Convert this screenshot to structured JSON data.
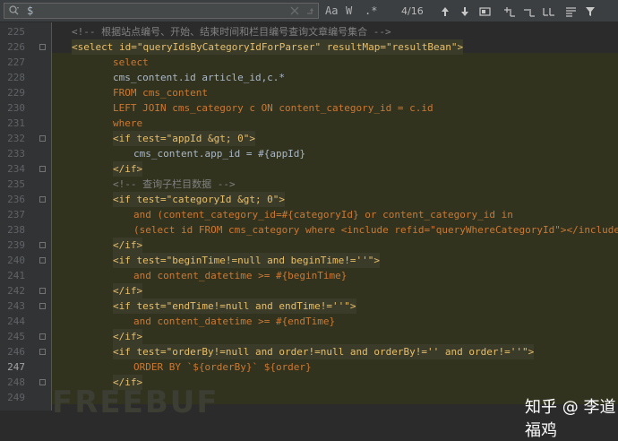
{
  "search": {
    "query": "$",
    "options": [
      "Aa",
      "W",
      ".*"
    ],
    "match_count": "4/16"
  },
  "icons": {
    "search": "search-icon",
    "clear": "clear-icon",
    "history": "history-icon",
    "prev": "arrow-up-icon",
    "next": "arrow-down-icon",
    "select_all": "select-all-occurrences-icon",
    "add": "add-selection-icon",
    "remove": "remove-selection-icon",
    "select_all_2": "select-all-icon",
    "multiline": "multiline-icon",
    "filter": "filter-icon"
  },
  "editor": {
    "current_line": 247,
    "lines": [
      {
        "num": "225",
        "text": "<!-- 根据站点编号、开始、结束时间和栏目编号查询文章编号集合 -->"
      },
      {
        "num": "226",
        "text": "<select id=\"queryIdsByCategoryIdForParser\" resultMap=\"resultBean\">"
      },
      {
        "num": "227",
        "text": "select"
      },
      {
        "num": "228",
        "text": "cms_content.id article_id,c.*"
      },
      {
        "num": "229",
        "text": "FROM cms_content"
      },
      {
        "num": "230",
        "text": "LEFT JOIN cms_category c ON content_category_id = c.id"
      },
      {
        "num": "231",
        "text": "where"
      },
      {
        "num": "232",
        "text": "<if test=\"appId &gt; 0\">"
      },
      {
        "num": "233",
        "text": "cms_content.app_id = #{appId}"
      },
      {
        "num": "234",
        "text": "</if>"
      },
      {
        "num": "235",
        "text": "<!-- 查询子栏目数据 -->"
      },
      {
        "num": "236",
        "text": "<if test=\"categoryId &gt; 0\">"
      },
      {
        "num": "237",
        "text": "and (content_category_id=#{categoryId} or content_category_id in"
      },
      {
        "num": "238",
        "text": "(select id FROM cms_category where <include refid=\"queryWhereCategoryId\"></include>))"
      },
      {
        "num": "239",
        "text": "</if>"
      },
      {
        "num": "240",
        "text": "<if test=\"beginTime!=null and beginTime!=''\">"
      },
      {
        "num": "241",
        "text": "and content_datetime >= #{beginTime}"
      },
      {
        "num": "242",
        "text": "</if>"
      },
      {
        "num": "243",
        "text": "<if test=\"endTime!=null and endTime!=''\">"
      },
      {
        "num": "244",
        "text": "and content_datetime >= #{endTime}"
      },
      {
        "num": "245",
        "text": "</if>"
      },
      {
        "num": "246",
        "text": "<if test=\"orderBy!=null and order!=null and orderBy!='' and order!=''\">"
      },
      {
        "num": "247",
        "text": "ORDER BY `${orderBy}` ${order}"
      },
      {
        "num": "248",
        "text": "</if>"
      },
      {
        "num": "249",
        "text": ""
      }
    ]
  },
  "watermarks": {
    "left": "FREEBUF",
    "right": "知乎 @ 李道福鸡"
  },
  "colors": {
    "background": "#2b2b2b",
    "region_highlight": "#32331f",
    "tag": "#e8bf6a",
    "keyword": "#cc7832",
    "string": "#6a8759",
    "comment": "#808080",
    "text": "#a9b7c6"
  }
}
